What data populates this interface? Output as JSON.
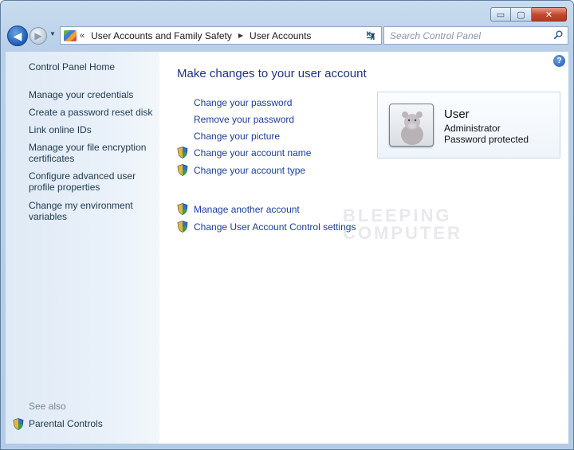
{
  "window": {
    "caption": {
      "minimize_glyph": "▭",
      "maximize_glyph": "▢",
      "close_glyph": "✕"
    }
  },
  "navigation": {
    "back_glyph": "◀",
    "forward_glyph": "▶",
    "recent_glyph": "▼",
    "address": {
      "overflow_glyph": "«",
      "segments": [
        "User Accounts and Family Safety",
        "User Accounts"
      ],
      "separator_glyph": "▶",
      "dropdown_glyph": "▼"
    },
    "refresh_glyph": "↹",
    "search": {
      "placeholder": "Search Control Panel"
    }
  },
  "sidebar": {
    "home": "Control Panel Home",
    "links": [
      "Manage your credentials",
      "Create a password reset disk",
      "Link online IDs",
      "Manage your file encryption certificates",
      "Configure advanced user profile properties",
      "Change my environment variables"
    ],
    "see_also": {
      "label": "See also",
      "items": [
        "Parental Controls"
      ]
    }
  },
  "content": {
    "help_glyph": "?",
    "title": "Make changes to your user account",
    "tasks": [
      "Change your password",
      "Remove your password",
      "Change your picture",
      "Change your account name",
      "Change your account type"
    ],
    "more_tasks": [
      "Manage another account",
      "Change User Account Control settings"
    ],
    "user": {
      "name": "User",
      "role": "Administrator",
      "status": "Password protected"
    },
    "watermark": [
      "BLEEPING",
      "COMPUTER"
    ]
  },
  "colors": {
    "link": "#1a3da0",
    "title": "#1e3287",
    "frame": "#b9d0e8"
  }
}
